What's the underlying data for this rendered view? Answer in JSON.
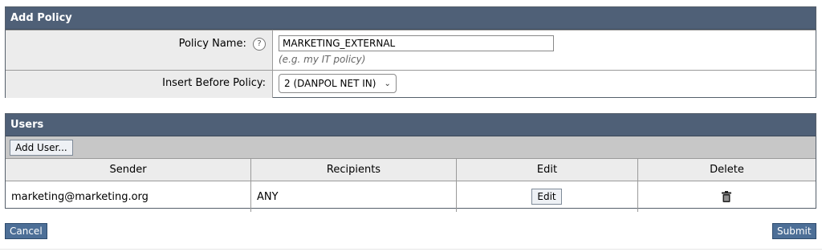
{
  "policy_panel": {
    "title": "Add Policy",
    "policy_name_label": "Policy Name:",
    "policy_name_value": "MARKETING_EXTERNAL",
    "policy_name_hint": "(e.g. my IT policy)",
    "insert_before_label": "Insert Before Policy:",
    "insert_before_value": "2 (DANPOL NET IN)"
  },
  "users_panel": {
    "title": "Users",
    "add_user_label": "Add User...",
    "columns": [
      "Sender",
      "Recipients",
      "Edit",
      "Delete"
    ],
    "rows": [
      {
        "sender": "marketing@marketing.org",
        "recipients": "ANY",
        "edit_label": "Edit"
      }
    ]
  },
  "actions": {
    "cancel_label": "Cancel",
    "submit_label": "Submit"
  },
  "icons": {
    "help": "help-icon",
    "dropdown": "chevron-down-icon",
    "delete": "trash-icon"
  }
}
